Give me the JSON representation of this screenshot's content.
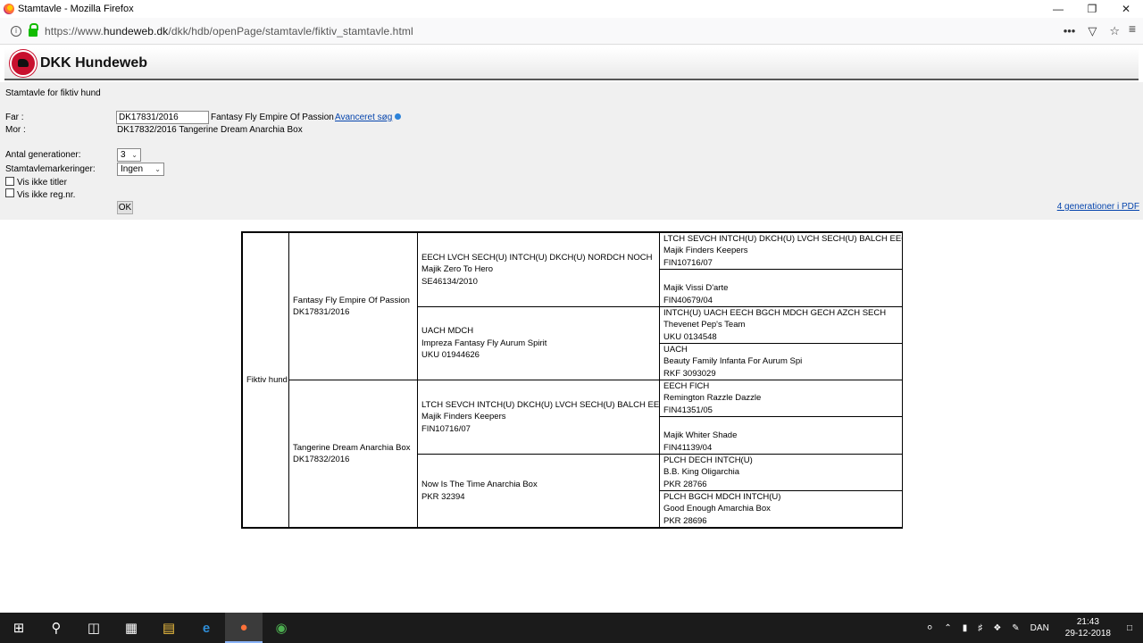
{
  "window": {
    "title": "Stamtavle - Mozilla Firefox"
  },
  "browser": {
    "url_prefix": "https://www.",
    "url_domain": "hundeweb.dk",
    "url_path": "/dkk/hdb/openPage/stamtavle/fiktiv_stamtavle.html",
    "more_label": "•••",
    "pocket_label": "▽",
    "star_label": "☆",
    "menu_label": "≡"
  },
  "site": {
    "name": "DKK Hundeweb"
  },
  "form": {
    "heading": "Stamtavle for fiktiv hund",
    "far_label": "Far :",
    "far_value": "DK17831/2016",
    "far_name": "Fantasy Fly Empire Of Passion",
    "advanced_link": "Avanceret søg",
    "mor_label": "Mor :",
    "mor_value": "DK17832/2016  Tangerine Dream Anarchia Box",
    "generations_label": "Antal generationer:",
    "generations_value": "3",
    "markings_label": "Stamtavlemarkeringer:",
    "markings_value": "Ingen",
    "hide_titles_label": "Vis ikke titler",
    "hide_regnr_label": "Vis ikke reg.nr.",
    "ok_label": "OK",
    "pdf_link": "4 generationer i PDF"
  },
  "pedigree": {
    "root": "Fiktiv hund",
    "gen1": [
      {
        "lines": [
          "Fantasy Fly Empire Of Passion",
          "DK17831/2016"
        ]
      },
      {
        "lines": [
          "Tangerine Dream Anarchia Box",
          "DK17832/2016"
        ]
      }
    ],
    "gen2": [
      {
        "lines": [
          "EECH LVCH SECH(U) INTCH(U) DKCH(U) NORDCH NOCH",
          "Majik Zero To Hero",
          "SE46134/2010"
        ]
      },
      {
        "lines": [
          "UACH MDCH",
          "Impreza Fantasy Fly Aurum Spirit",
          "UKU 01944626"
        ]
      },
      {
        "lines": [
          "LTCH SEVCH INTCH(U) DKCH(U) LVCH SECH(U) BALCH EECH",
          "Majik Finders Keepers",
          "FIN10716/07"
        ]
      },
      {
        "lines": [
          "Now Is The Time Anarchia Box",
          "PKR 32394"
        ]
      }
    ],
    "gen3": [
      {
        "lines": [
          "LTCH SEVCH INTCH(U) DKCH(U) LVCH SECH(U) BALCH EECH",
          "Majik Finders Keepers",
          "FIN10716/07"
        ]
      },
      {
        "lines": [
          "",
          "Majik Vissi D'arte",
          "FIN40679/04"
        ]
      },
      {
        "lines": [
          "INTCH(U) UACH EECH BGCH MDCH GECH AZCH SECH",
          "Thevenet Pep's Team",
          "UKU 0134548"
        ]
      },
      {
        "lines": [
          "UACH",
          "Beauty Family Infanta For Aurum Spi",
          "RKF 3093029"
        ]
      },
      {
        "lines": [
          "EECH FICH",
          "Remington Razzle Dazzle",
          "FIN41351/05"
        ]
      },
      {
        "lines": [
          "",
          "Majik Whiter Shade",
          "FIN41139/04"
        ]
      },
      {
        "lines": [
          "PLCH DECH INTCH(U)",
          "B.B. King Oligarchia",
          "PKR 28766"
        ]
      },
      {
        "lines": [
          "PLCH BGCH MDCH INTCH(U)",
          "Good Enough Amarchia Box",
          "PKR 28696"
        ]
      }
    ]
  },
  "taskbar": {
    "language": "DAN",
    "time": "21:43",
    "date": "29-12-2018"
  }
}
